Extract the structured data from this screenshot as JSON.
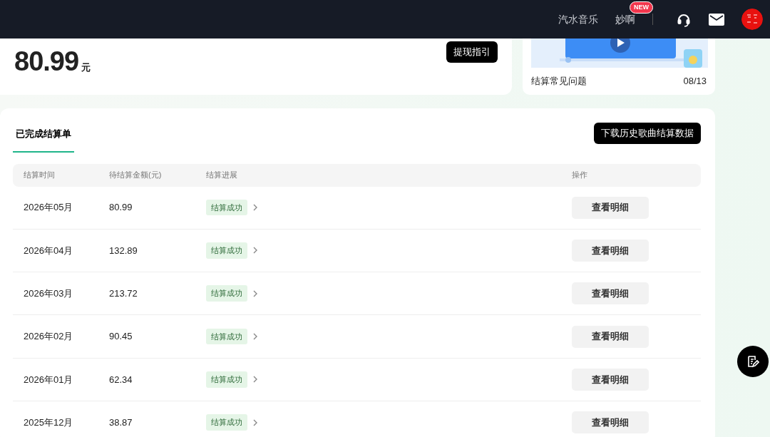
{
  "topbar": {
    "links": [
      {
        "label": "汽水音乐"
      },
      {
        "label": "妙啊",
        "badge": "NEW"
      }
    ]
  },
  "balance": {
    "amount": "80.99",
    "unit": "元",
    "guide_button": "提现指引"
  },
  "faq": {
    "title": "结算常见问题",
    "date": "08/13"
  },
  "settlements": {
    "tabs": [
      {
        "label": "已完成结算单",
        "selected": true
      }
    ],
    "download_button": "下载历史歌曲结算数据",
    "table": {
      "columns": [
        "结算时间",
        "待结算金额(元)",
        "结算进展",
        "操作"
      ],
      "rows": [
        {
          "period": "2026年05月",
          "amount": "80.99",
          "status": "结算成功",
          "action": "查看明细"
        },
        {
          "period": "2026年04月",
          "amount": "132.89",
          "status": "结算成功",
          "action": "查看明细"
        },
        {
          "period": "2026年03月",
          "amount": "213.72",
          "status": "结算成功",
          "action": "查看明细"
        },
        {
          "period": "2026年02月",
          "amount": "90.45",
          "status": "结算成功",
          "action": "查看明细"
        },
        {
          "period": "2026年01月",
          "amount": "62.34",
          "status": "结算成功",
          "action": "查看明细"
        },
        {
          "period": "2025年12月",
          "amount": "38.87",
          "status": "结算成功",
          "action": "查看明细"
        }
      ]
    }
  }
}
